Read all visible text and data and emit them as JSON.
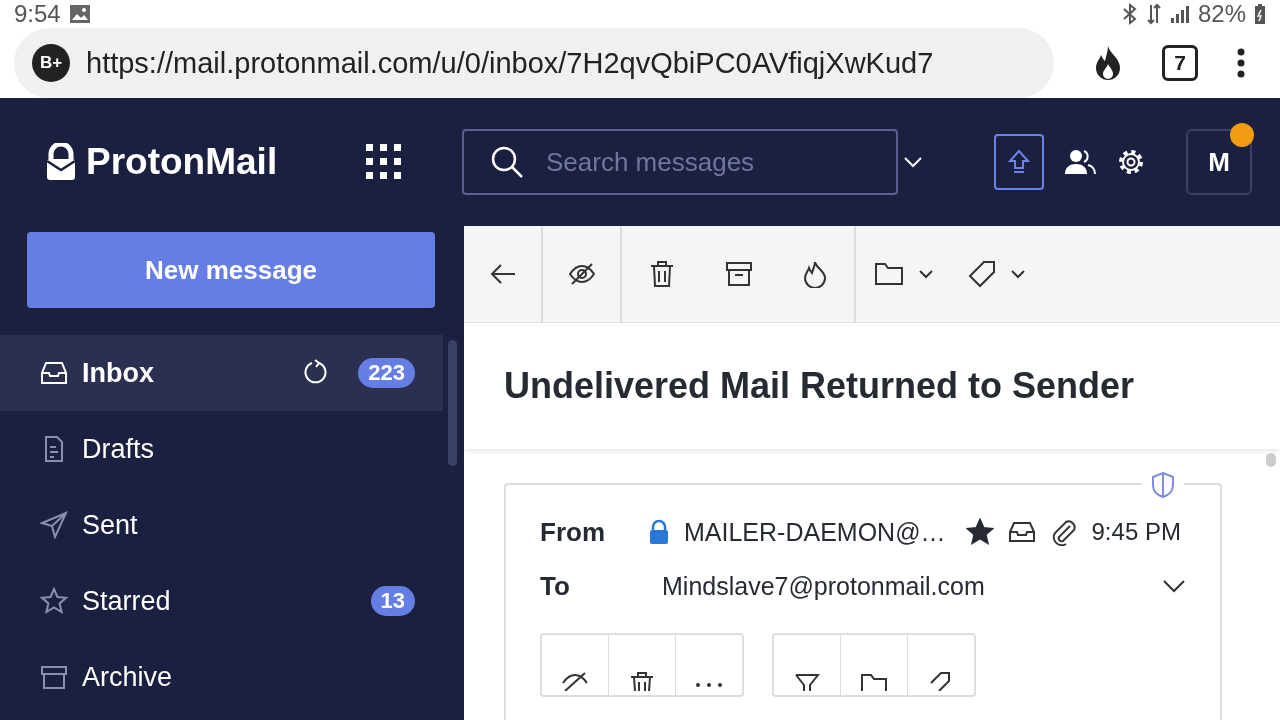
{
  "status_bar": {
    "time": "9:54",
    "battery": "82%"
  },
  "browser": {
    "site_badge": "B+",
    "url": "https://mail.protonmail.com/u/0/inbox/7H2qvQbiPC0AVfiqjXwKud7",
    "tab_count": "7"
  },
  "header": {
    "logo": "ProtonMail",
    "search": {
      "placeholder": "Search messages"
    },
    "avatar": "M",
    "notification": true
  },
  "sidebar": {
    "new_message": "New message",
    "items": [
      {
        "label": "Inbox",
        "selected": true,
        "count": "223",
        "refresh": true
      },
      {
        "label": "Drafts",
        "selected": false
      },
      {
        "label": "Sent",
        "selected": false
      },
      {
        "label": "Starred",
        "selected": false,
        "count": "13"
      },
      {
        "label": "Archive",
        "selected": false
      }
    ]
  },
  "message": {
    "subject": "Undelivered Mail Returned to Sender",
    "from_label": "From",
    "sender": "MAILER-DAEMON@…",
    "starred": true,
    "time": "9:45 PM",
    "to_label": "To",
    "recipient": "Mindslave7@protonmail.com"
  }
}
